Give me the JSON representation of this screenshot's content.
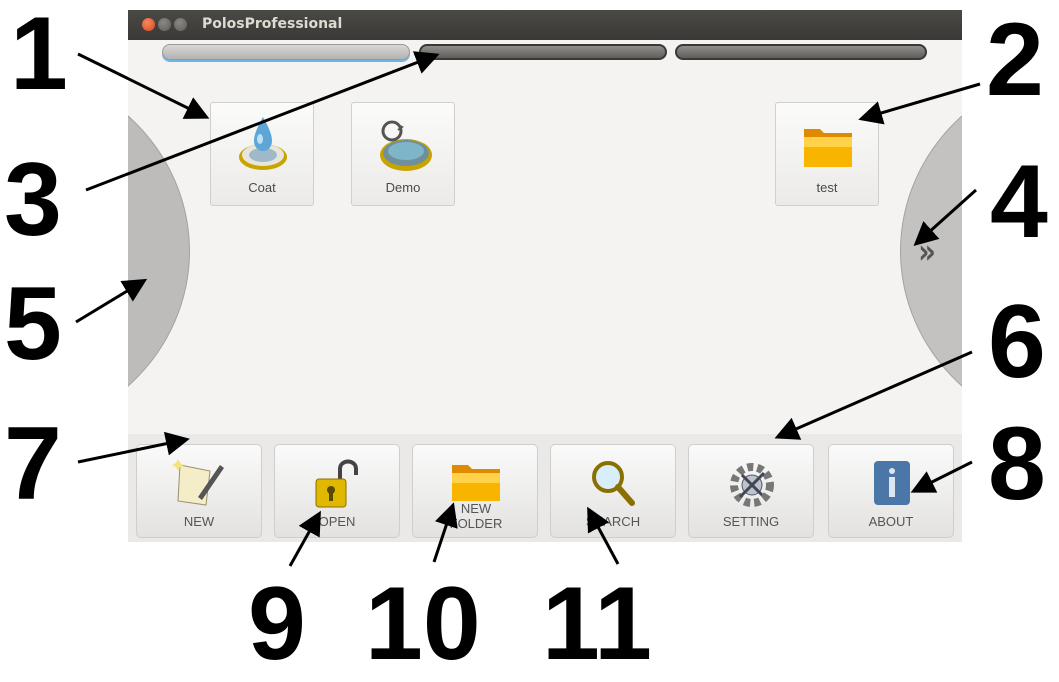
{
  "window": {
    "title": "PolosProfessional"
  },
  "page_indicator": {
    "pages": 3,
    "current": 1
  },
  "tiles": [
    {
      "label": "Coat",
      "icon": "coat-drop-icon"
    },
    {
      "label": "Demo",
      "icon": "demo-disc-icon"
    },
    {
      "label": "test",
      "icon": "folder-icon"
    }
  ],
  "nav": {
    "next_icon": "double-chevron-right-icon"
  },
  "toolbar": {
    "new_label": "NEW",
    "open_label": "OPEN",
    "new_folder_label": "NEW FOLDER",
    "search_label": "SEARCH",
    "setting_label": "SETTING",
    "about_label": "ABOUT"
  },
  "callouts": [
    "1",
    "2",
    "3",
    "4",
    "5",
    "6",
    "7",
    "8",
    "9",
    "10",
    "11"
  ],
  "colors": {
    "title_bar": "#3c3b37",
    "accent_blue": "#6fb4e6",
    "folder_yellow": "#f7b500",
    "about_blue": "#4a76a8"
  }
}
